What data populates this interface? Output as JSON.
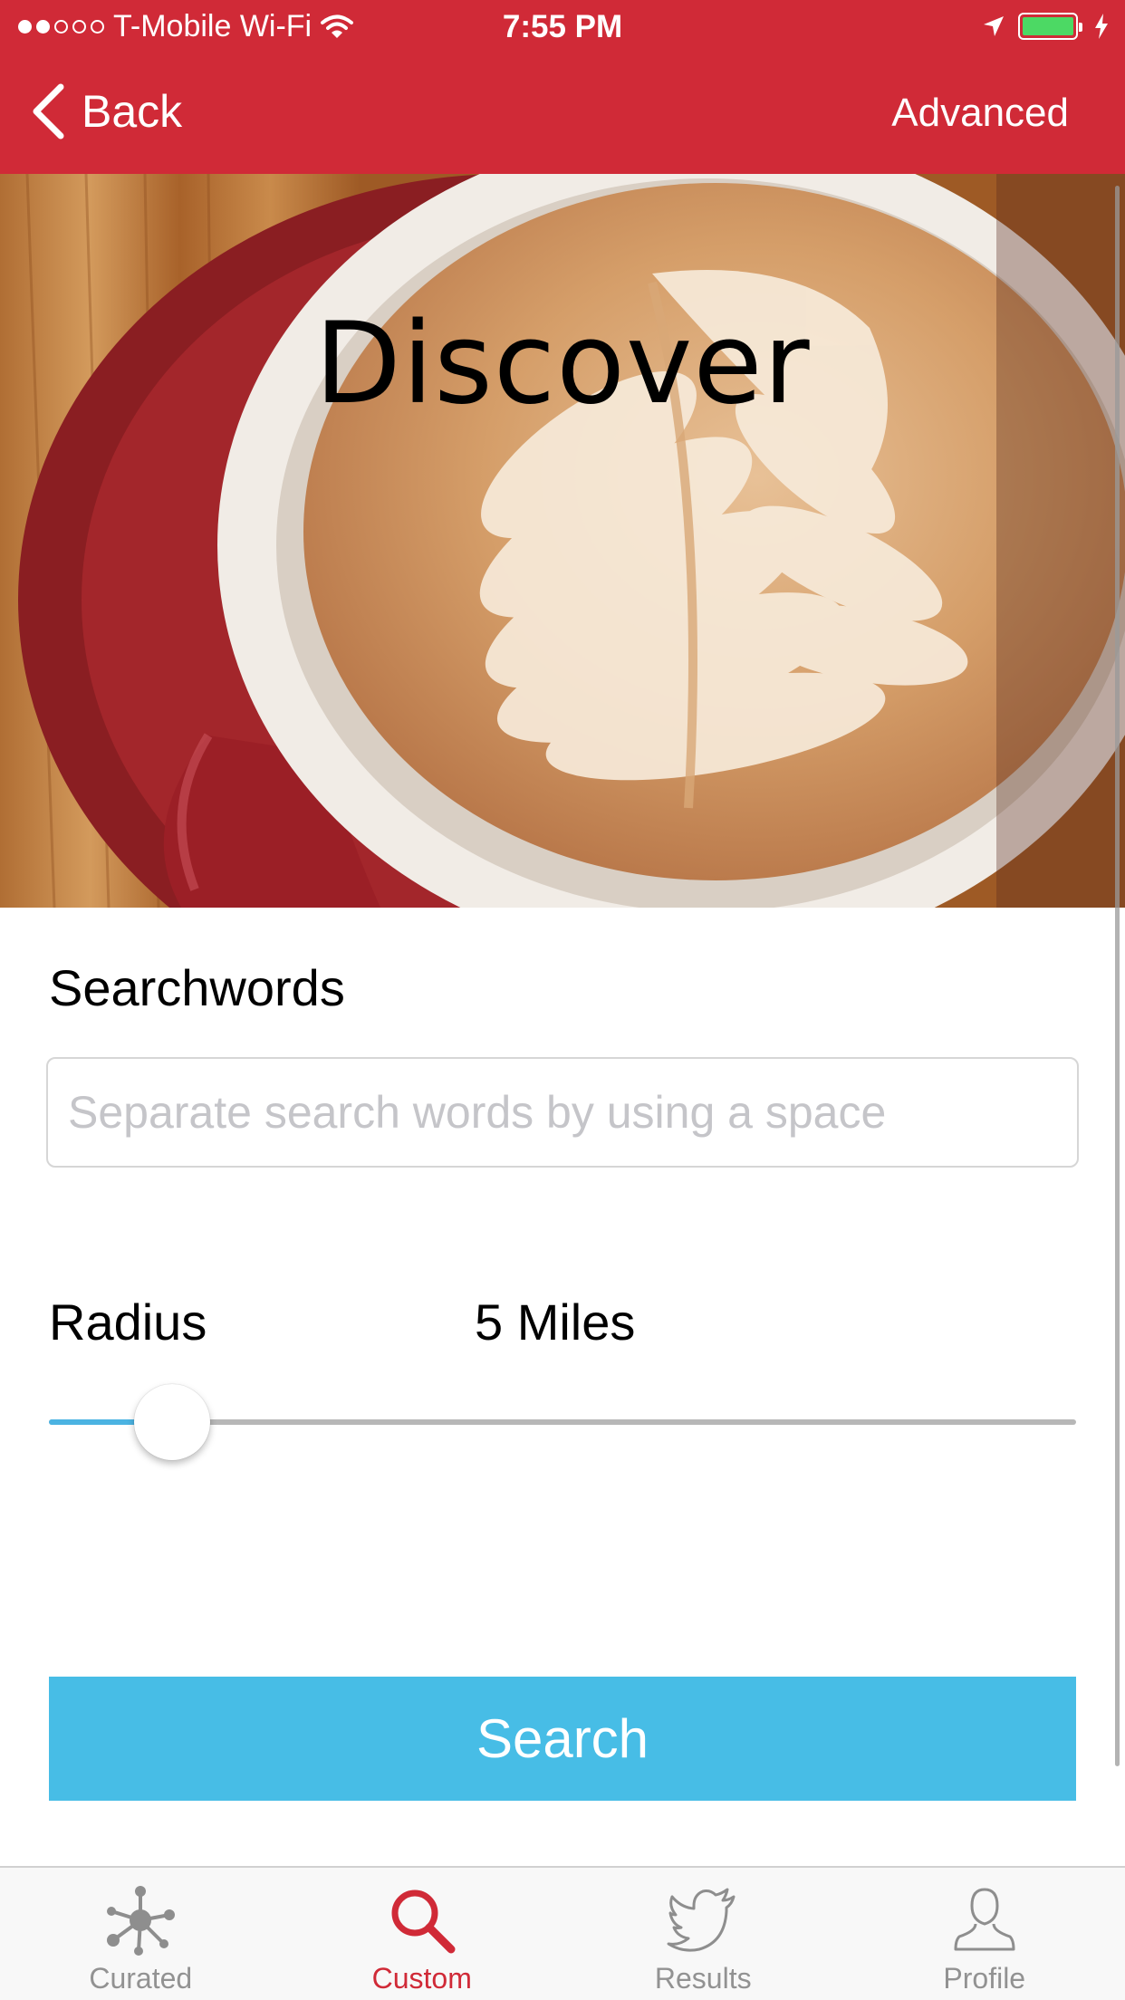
{
  "status_bar": {
    "carrier": "T-Mobile Wi-Fi",
    "time": "7:55 PM",
    "signal_bars_filled": 2,
    "signal_bars_total": 5,
    "battery_level": 1.0,
    "icons": [
      "wifi-icon",
      "location-arrow-icon",
      "battery-icon",
      "charging-bolt-icon"
    ]
  },
  "navbar": {
    "back_label": "Back",
    "advanced_label": "Advanced",
    "background_color": "#d02a37"
  },
  "hero": {
    "title": "Discover",
    "image_description_icon": "latte-art-photo"
  },
  "form": {
    "searchwords_label": "Searchwords",
    "search_input_value": "",
    "search_input_placeholder": "Separate search words by using a space",
    "radius_label": "Radius",
    "radius_value": "5 Miles",
    "radius_slider_fraction": 0.12,
    "slider_fill_color": "#4bb3e2",
    "search_button_label": "Search",
    "search_button_color": "#47bde6"
  },
  "tabbar": {
    "active_color": "#d02a37",
    "inactive_color": "#929292",
    "tabs": [
      {
        "label": "Curated",
        "icon": "network-icon",
        "active": false
      },
      {
        "label": "Custom",
        "icon": "search-icon",
        "active": true
      },
      {
        "label": "Results",
        "icon": "twitter-bird-icon",
        "active": false
      },
      {
        "label": "Profile",
        "icon": "person-icon",
        "active": false
      }
    ]
  }
}
